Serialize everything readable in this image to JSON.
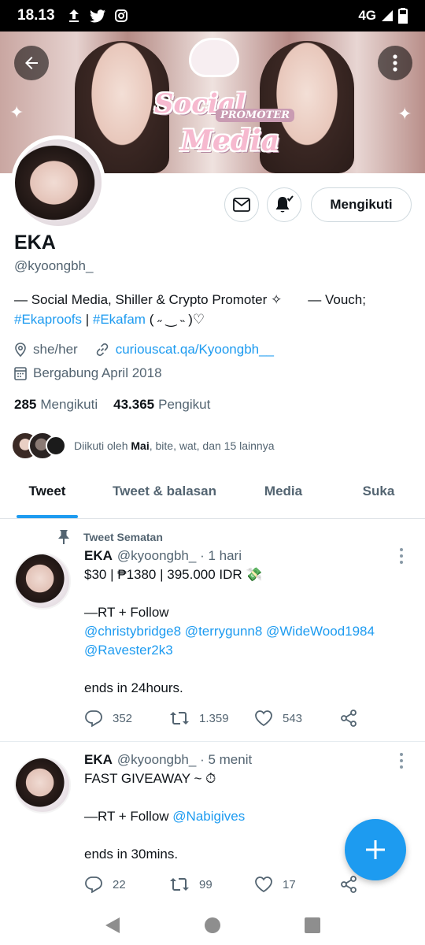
{
  "status_bar": {
    "time": "18.13",
    "network": "4G"
  },
  "profile": {
    "display_name": "EKA",
    "handle": "@kyoongbh_",
    "bio_line1": "— Social Media, Shiller & Crypto Promoter ✧       — Vouch;",
    "bio_tag1": "#Ekaproofs",
    "bio_sep": " | ",
    "bio_tag2": "#Ekafam",
    "bio_tail": " ( ˶ ‿ ˵ )♡",
    "pronouns": "she/her",
    "website": "curiouscat.qa/Kyoongbh__",
    "joined": "Bergabung April 2018",
    "following_count": "285",
    "following_label": "Mengikuti",
    "followers_count": "43.365",
    "followers_label": "Pengikut",
    "followed_by_prefix": "Diikuti oleh ",
    "followed_by_bold": "Mai",
    "followed_by_rest": ", bite, wat, dan 15 lainnya"
  },
  "banner": {
    "line1": "Social",
    "line2": "PROMOTER",
    "line3": "Media"
  },
  "buttons": {
    "follow_label": "Mengikuti"
  },
  "tabs": [
    {
      "label": "Tweet"
    },
    {
      "label": "Tweet & balasan"
    },
    {
      "label": "Media"
    },
    {
      "label": "Suka"
    }
  ],
  "tweets": [
    {
      "pinned_label": "Tweet Sematan",
      "name": "EKA",
      "meta": "@kyoongbh_ · 1 hari",
      "line1": "$30 | ₱1380 | 395.000 IDR 💸",
      "line2": "—RT + Follow",
      "mentions1": "@christybridge8 @terrygunn8 @WideWood1984",
      "mentions2": "@Ravester2k3",
      "line3": "ends in 24hours.",
      "replies": "352",
      "retweets": "1.359",
      "likes": "543"
    },
    {
      "name": "EKA",
      "meta": "@kyoongbh_ · 5 menit",
      "line1": "FAST GIVEAWAY ~ ⏱",
      "line2_prefix": "—RT + Follow ",
      "line2_mention": "@Nabigives",
      "line3": "ends in 30mins.",
      "replies": "22",
      "retweets": "99",
      "likes": "17"
    }
  ],
  "colors": {
    "accent": "#1d9bf0",
    "text": "#0f1419",
    "muted": "#536471"
  }
}
